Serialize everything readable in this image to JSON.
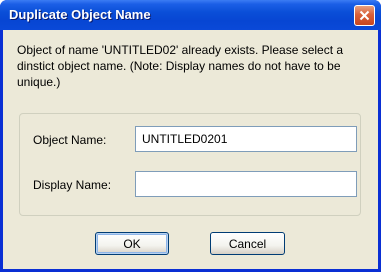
{
  "window": {
    "title": "Duplicate Object Name",
    "close_icon": "close-icon"
  },
  "message": "Object of name 'UNTITLED02' already exists.  Please select a dinstict object name. (Note: Display names do not have to be unique.)",
  "form": {
    "object_name_label": "Object Name:",
    "object_name_value": "UNTITLED0201",
    "display_name_label": "Display Name:",
    "display_name_value": ""
  },
  "buttons": {
    "ok_label": "OK",
    "cancel_label": "Cancel"
  },
  "colors": {
    "titlebar": "#0a4fd8",
    "dialog_bg": "#ece9d8",
    "close_button": "#d9603a"
  }
}
